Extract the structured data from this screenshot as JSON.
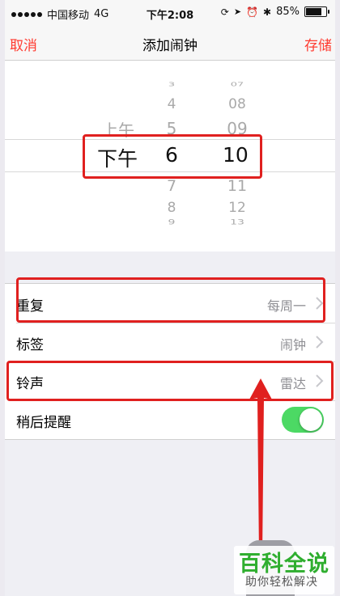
{
  "status_bar": {
    "carrier": "中国移动",
    "network": "4G",
    "time": "下午2:08",
    "battery_percent_text": "85%",
    "battery_level": 0.85
  },
  "nav": {
    "cancel_label": "取消",
    "title": "添加闹钟",
    "save_label": "存储",
    "accent_color": "#ff3b30"
  },
  "picker": {
    "ampm": {
      "above": [
        "上午"
      ],
      "selected": "下午"
    },
    "hours": {
      "above": [
        "3",
        "4",
        "5"
      ],
      "selected": "6",
      "below": [
        "7",
        "8",
        "9"
      ]
    },
    "minutes": {
      "above": [
        "07",
        "08",
        "09"
      ],
      "selected": "10",
      "below": [
        "11",
        "12",
        "13"
      ]
    }
  },
  "settings": [
    {
      "label": "重复",
      "value": "每周一",
      "has_chevron": true
    },
    {
      "label": "标签",
      "value": "闹钟",
      "has_chevron": true
    },
    {
      "label": "铃声",
      "value": "雷达",
      "has_chevron": true
    },
    {
      "label": "稍后提醒",
      "toggle_on": true
    }
  ],
  "toggle_color": "#4cd964",
  "annotation_color": "#e0201f",
  "watermark": {
    "title": "百科全说",
    "subtitle": "助你轻松解决"
  }
}
